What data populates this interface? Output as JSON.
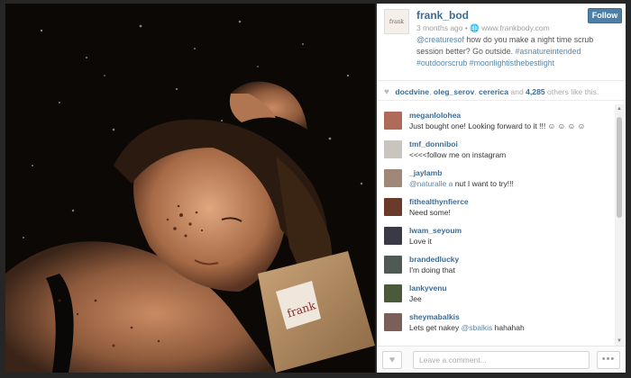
{
  "post": {
    "username": "frank_bod",
    "avatar_text": "frank",
    "time_ago": "3 months ago",
    "location_separator": "•",
    "website": "www.frankbody.com",
    "follow_label": "Follow",
    "caption_mention": "@creaturesof",
    "caption_text": " how do you make a night time scrub session better? Go outside. ",
    "caption_tags": "#asnatureintended #outdoorscrub #moonlightisthebestlight",
    "photo_label": "frank"
  },
  "likes": {
    "liker1": "docdvine",
    "liker2": "oleg_serov",
    "liker3": "cererica",
    "and_text": " and ",
    "count": "4,285",
    "suffix": " others like this."
  },
  "comments": [
    {
      "user": "meganlolohea",
      "text": "Just bought one! Looking forward to it !!! ☺ ☺ ☺ ☺",
      "mention": "",
      "avatar_color": "#b06a5a"
    },
    {
      "user": "tmf_donniboi",
      "text": "<<<<follow me on instagram",
      "mention": "",
      "avatar_color": "#c9c4bd"
    },
    {
      "user": "_jaylamb",
      "text": " nut I want to try!!!",
      "mention": "@naturalle  a",
      "avatar_color": "#a08878"
    },
    {
      "user": "fithealthynfierce",
      "text": "Need some!",
      "mention": "",
      "avatar_color": "#6a3a2a"
    },
    {
      "user": "lwam_seyoum",
      "text": "Love it",
      "mention": "",
      "avatar_color": "#3a3a46"
    },
    {
      "user": "brandedlucky",
      "text": "I'm doing that",
      "mention": "",
      "avatar_color": "#505a54"
    },
    {
      "user": "lankyvenu",
      "text": "Jee",
      "mention": "",
      "avatar_color": "#4a5a3a"
    },
    {
      "user": "sheymabalkis",
      "text": " hahahah",
      "mention": "@sbalkis",
      "prefix": "Lets get nakey ",
      "avatar_color": "#7a6058"
    }
  ],
  "comment_input": {
    "placeholder": "Leave a comment..."
  },
  "icons": {
    "heart": "heart-icon",
    "more": "more-icon",
    "globe": "globe-icon"
  },
  "colors": {
    "link_blue": "#3b6c96",
    "follow_blue": "#4d7fa7"
  }
}
